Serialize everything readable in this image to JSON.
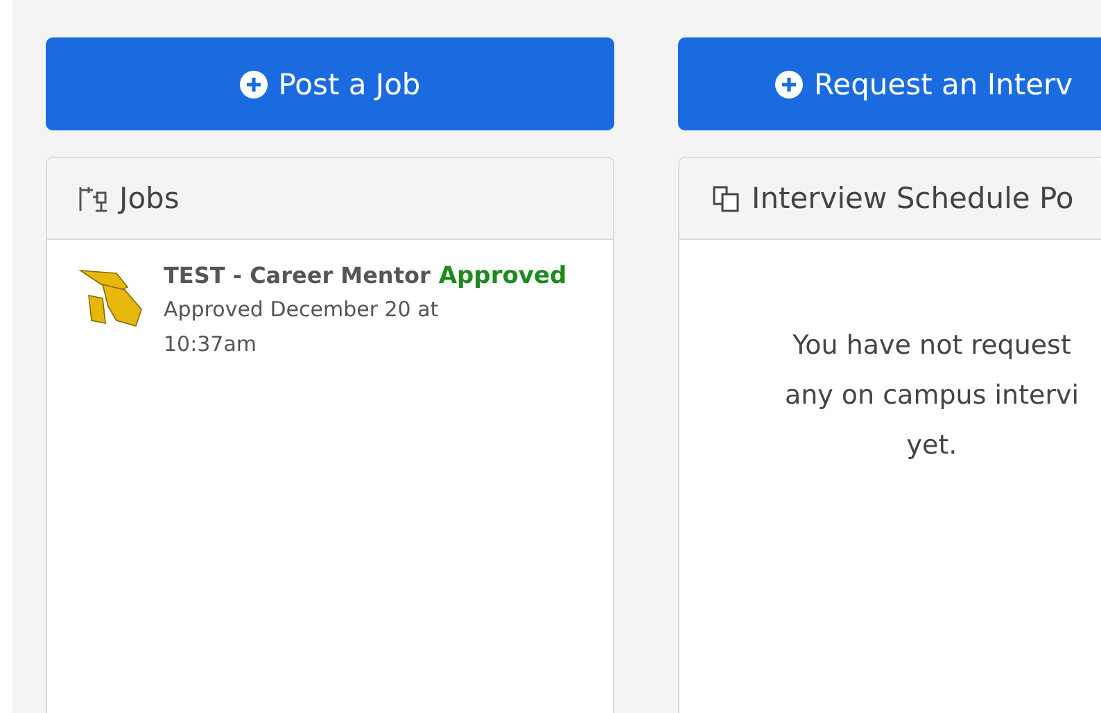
{
  "actions": [
    {
      "label": "Post a Job"
    },
    {
      "label": "Request an Interv"
    }
  ],
  "jobs_panel": {
    "title": "Jobs",
    "items": [
      {
        "title": "TEST - Career Mentor",
        "status": "Approved",
        "kind": "approved",
        "date": "Approved December 20 at 10:37am"
      }
    ]
  },
  "interview_panel": {
    "title": "Interview Schedule Po",
    "message": "You have not request any on campus intervi yet."
  }
}
